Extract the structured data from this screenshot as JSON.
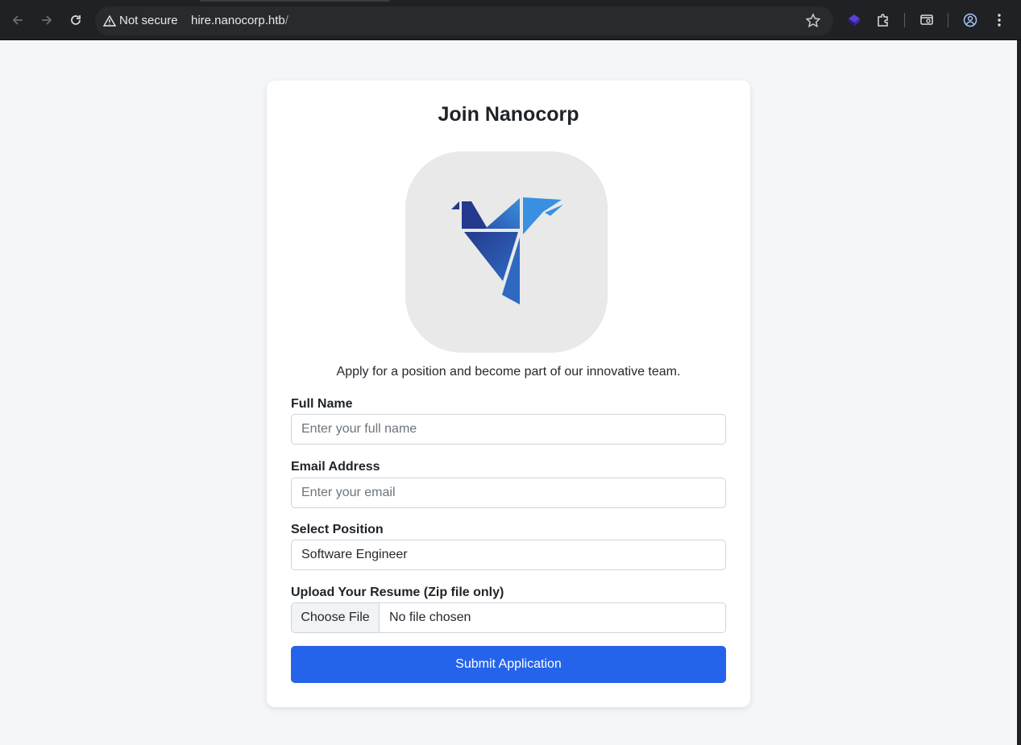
{
  "browser": {
    "security_label": "Not secure",
    "url_host": "hire.nanocorp.htb",
    "url_path": "/"
  },
  "page": {
    "title": "Join Nanocorp",
    "subtitle": "Apply for a position and become part of our innovative team.",
    "logo_icon": "origami-bird-logo",
    "fields": {
      "full_name": {
        "label": "Full Name",
        "placeholder": "Enter your full name"
      },
      "email": {
        "label": "Email Address",
        "placeholder": "Enter your email"
      },
      "position": {
        "label": "Select Position",
        "value": "Software Engineer"
      },
      "resume": {
        "label": "Upload Your Resume (Zip file only)",
        "button": "Choose File",
        "status": "No file chosen"
      }
    },
    "submit_label": "Submit Application"
  },
  "colors": {
    "primary": "#2563eb",
    "background": "#f5f6f8",
    "logo_dark": "#253c8e",
    "logo_light": "#3b8ee0"
  }
}
